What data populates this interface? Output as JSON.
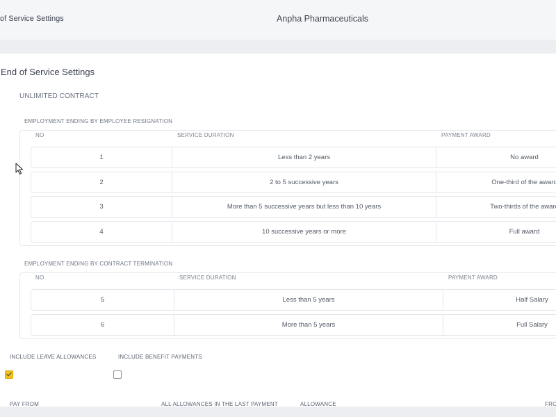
{
  "header": {
    "breadcrumb": "of Service Settings",
    "company": "Anpha Pharmaceuticals"
  },
  "page": {
    "title": "End of Service Settings",
    "contract_type": "UNLIMITED CONTRACT"
  },
  "resignation": {
    "title": "EMPLOYMENT ENDING BY EMPLOYEE RESIGNATION",
    "headers": {
      "no": "NO",
      "duration": "SERVICE DURATION",
      "award": "PAYMENT AWARD"
    },
    "rows": [
      {
        "no": "1",
        "duration": "Less than 2 years",
        "award": "No award"
      },
      {
        "no": "2",
        "duration": "2 to 5 successive years",
        "award": "One-third of the award"
      },
      {
        "no": "3",
        "duration": "More than 5 successive years but less than 10 years",
        "award": "Two-thirds of the award"
      },
      {
        "no": "4",
        "duration": "10 successive years or more",
        "award": "Full award"
      }
    ]
  },
  "termination": {
    "title": "EMPLOYMENT ENDING BY CONTRACT TERMINATION",
    "headers": {
      "no": "NO",
      "duration": "SERVICE DURATION",
      "award": "PAYMENT AWARD"
    },
    "rows": [
      {
        "no": "5",
        "duration": "Less than 5 years",
        "award": "Half Salary"
      },
      {
        "no": "6",
        "duration": "More than 5 years",
        "award": "Full Salary"
      }
    ]
  },
  "options": {
    "leave_allowances": {
      "label": "INCLUDE LEAVE ALLOWANCES",
      "checked": true
    },
    "benefit_payments": {
      "label": "INCLUDE BENEFIT PAYMENTS",
      "checked": false
    }
  },
  "footer_fields": {
    "pay_from": "PAY FROM",
    "all_allowances": "ALL ALLOWANCES IN THE LAST PAYMENT",
    "allowance": "ALLOWANCE",
    "from": "FRO"
  },
  "colors": {
    "accent_checkbox": "#f2c21a",
    "border": "#e3e6eb",
    "page_bg": "#eef0f4"
  }
}
